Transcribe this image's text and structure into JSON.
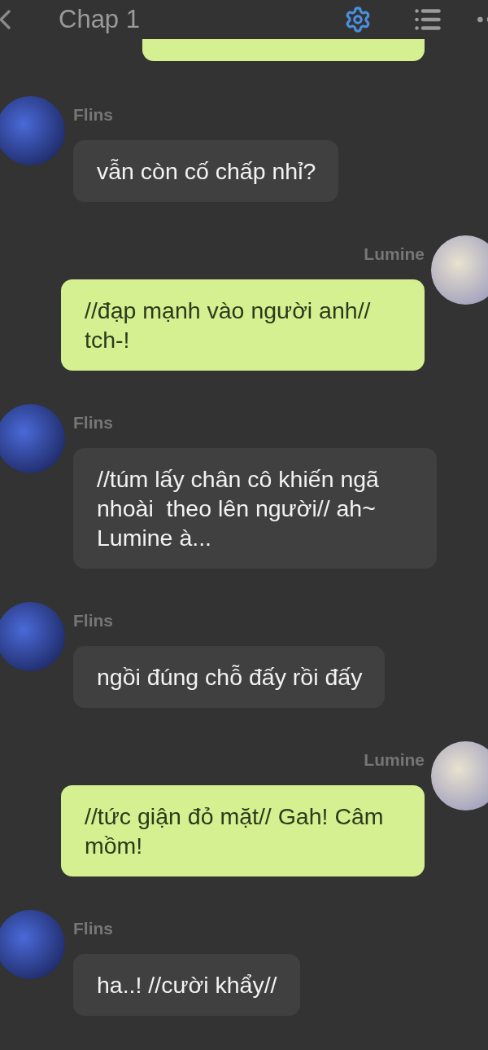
{
  "header": {
    "title": "Chap 1"
  },
  "messages": [
    {
      "kind": "partial"
    },
    {
      "kind": "incoming",
      "sender": "Flins",
      "text": "vẫn còn cố chấp nhỉ?"
    },
    {
      "kind": "outgoing",
      "sender": "Lumine",
      "text": "//đạp mạnh vào người anh// tch-!"
    },
    {
      "kind": "incoming",
      "sender": "Flins",
      "text": "//túm lấy chân cô khiến ngã nhoài  theo lên người// ah~ Lumine à..."
    },
    {
      "kind": "incoming",
      "sender": "Flins",
      "text": "ngồi đúng chỗ đấy rồi đấy"
    },
    {
      "kind": "outgoing",
      "sender": "Lumine",
      "text": "//tức giận đỏ mặt// Gah! Câm mồm!"
    },
    {
      "kind": "incoming",
      "sender": "Flins",
      "text": "ha..! //cười khẩy//"
    }
  ]
}
